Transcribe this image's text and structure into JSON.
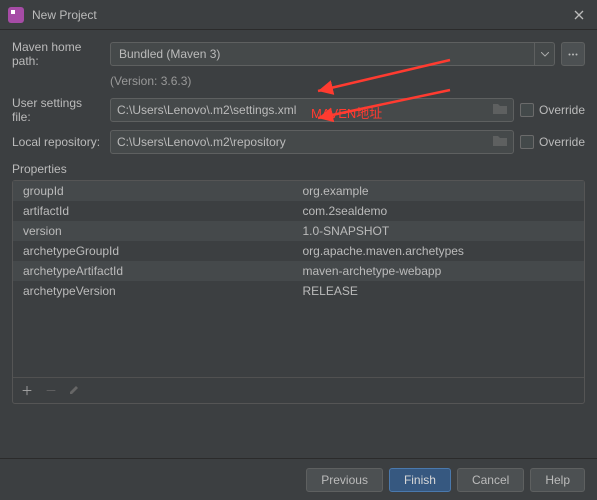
{
  "titlebar": {
    "title": "New Project"
  },
  "fields": {
    "mavenHomeLabel": "Maven home path:",
    "mavenHomeValue": "Bundled (Maven 3)",
    "versionText": "(Version: 3.6.3)",
    "userSettingsLabel": "User settings file:",
    "userSettingsValue": "C:\\Users\\Lenovo\\.m2\\settings.xml",
    "localRepoLabel": "Local repository:",
    "localRepoValue": "C:\\Users\\Lenovo\\.m2\\repository",
    "overrideLabel": "Override"
  },
  "annotation": {
    "text": "MAVEN地址"
  },
  "propertiesLabel": "Properties",
  "properties": [
    {
      "k": "groupId",
      "v": "org.example"
    },
    {
      "k": "artifactId",
      "v": "com.2sealdemo"
    },
    {
      "k": "version",
      "v": "1.0-SNAPSHOT"
    },
    {
      "k": "archetypeGroupId",
      "v": "org.apache.maven.archetypes"
    },
    {
      "k": "archetypeArtifactId",
      "v": "maven-archetype-webapp"
    },
    {
      "k": "archetypeVersion",
      "v": "RELEASE"
    }
  ],
  "footer": {
    "previous": "Previous",
    "finish": "Finish",
    "cancel": "Cancel",
    "help": "Help"
  }
}
